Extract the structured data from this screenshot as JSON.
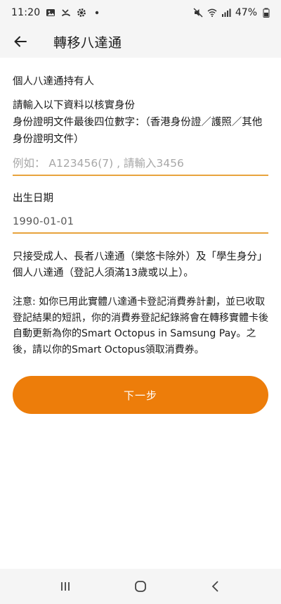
{
  "status": {
    "time": "11:20",
    "battery": "47%",
    "left_icons": [
      "image-icon",
      "missed-call-icon",
      "settings-icon",
      "dot-icon"
    ],
    "right_icons": [
      "mute-icon",
      "wifi-icon",
      "signal-icon",
      "battery-icon"
    ]
  },
  "header": {
    "title": "轉移八達通"
  },
  "form": {
    "section_title": "個人八達通持有人",
    "instruction_1": "請輸入以下資料以核實身份",
    "instruction_2": "身份證明文件最後四位數字：（香港身份證／護照／其他身份證明文件）",
    "id_placeholder": "例如： A123456(7) , 請輸入3456",
    "id_value": "",
    "dob_label": "出生日期",
    "dob_value": "1990-01-01"
  },
  "notes": {
    "eligibility": "只接受成人、長者八達通（樂悠卡除外）及「學生身分」個人八達通（登記人須滿13歲或以上）。",
    "notice": "注意: 如你已用此實體八達通卡登記消費券計劃，並已收取登記結果的短訊，你的消費券登記紀錄將會在轉移實體卡後自動更新為你的Smart Octopus in Samsung Pay。之後，請以你的Smart Octopus領取消費券。"
  },
  "actions": {
    "next_label": "下一步"
  },
  "colors": {
    "accent": "#ed7d0a",
    "underline": "#e8a33d",
    "bar_bg": "#f5f5f5"
  }
}
